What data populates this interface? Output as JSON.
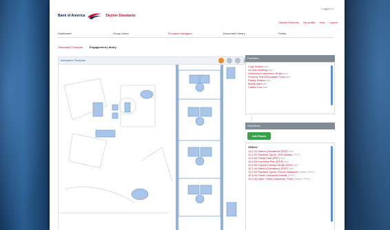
{
  "header": {
    "bank_name": "Bank of America",
    "product_name": "Skyline Standards",
    "utility_text": "Logged in",
    "links": [
      "Skyline Directory",
      "My profile",
      "Help",
      "Logout"
    ]
  },
  "nav": {
    "tabs": [
      "Dashboard",
      "Group Users",
      "Floorplan Navigator",
      "Document Library",
      "Feeds"
    ],
    "active_index": 2
  },
  "subnav": {
    "items": [
      "Standards Floorplan",
      "Engagement Library"
    ]
  },
  "map": {
    "title": "Interactive Floorplan",
    "tools": [
      "home-icon",
      "gear-icon",
      "zoom-in-icon",
      "zoom-out-icon"
    ]
  },
  "favorites": {
    "title": "Favorites",
    "items": [
      {
        "label": "Coat Station",
        "suffix": "see"
      },
      {
        "label": "On-line Banking",
        "suffix": "see"
      },
      {
        "label": "Universal Conference Room",
        "suffix": "see"
      },
      {
        "label": "Point by Point Floorplate Tools",
        "suffix": "see"
      },
      {
        "label": "Pantry Station",
        "suffix": "see"
      },
      {
        "label": "Media Wall",
        "suffix": "see"
      },
      {
        "label": "Coffee Corr",
        "suffix": "see"
      }
    ]
  },
  "guidelines": {
    "title": "Guidelines",
    "add_button": "Add Room",
    "group_header": "Offices",
    "items": [
      {
        "label": "10.1.01 Interior Elevations (PDF)",
        "suffix": "see"
      },
      {
        "label": "10.2.02 Partition Types, TEB Details",
        "suffix": "(PDF)"
      },
      {
        "label": "10.3.03 Finish Plan (PDF)",
        "suffix": "see"
      },
      {
        "label": "10.4.04 Furniture Plan (PDF)",
        "suffix": "see"
      },
      {
        "label": "10.5.05 Typical Ceiling Details (PDF)",
        "suffix": "see"
      },
      {
        "label": "10.1.01 Interior Elevations (PDF)",
        "suffix": "see"
      },
      {
        "label": "10.2.02 Partition Types, Fixed Casework",
        "suffix": "Details (PDF)"
      },
      {
        "label": "10.3.03 Fixed Casework Details",
        "suffix": "(PDF)"
      },
      {
        "label": "10.4.04 Main, Fixed Casework, Pixel",
        "suffix": "Details (PDF)"
      }
    ]
  },
  "colors": {
    "brand_red": "#c41230",
    "brand_blue": "#012169",
    "panel_header": "#7f8c95",
    "add_button": "#3aa14a",
    "furniture_blue": "#a9c6e8"
  }
}
